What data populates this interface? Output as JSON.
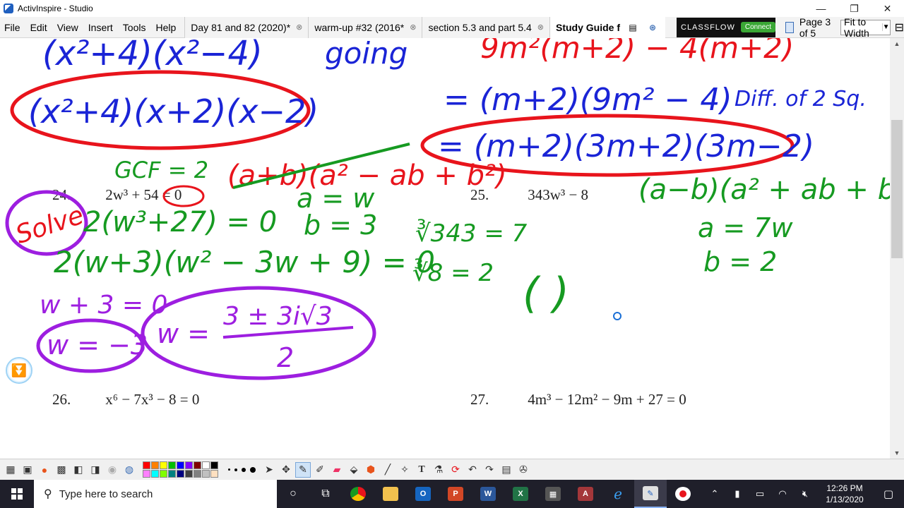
{
  "window": {
    "title": "ActivInspire - Studio",
    "controls": {
      "minimize": "—",
      "restore": "❐",
      "close": "✕"
    }
  },
  "menu": [
    "File",
    "Edit",
    "View",
    "Insert",
    "Tools",
    "Help"
  ],
  "tabs": [
    {
      "label": "Day 81 and 82 (2020)*",
      "active": false
    },
    {
      "label": "warm-up #32 (2016*",
      "active": false
    },
    {
      "label": "section 5.3 and part 5.4",
      "active": false
    },
    {
      "label": "Study Guide f",
      "active": true
    }
  ],
  "classflow": {
    "label": "CLASSFLOW",
    "connect": "Connect"
  },
  "page_indicator": "Page 3 of 5",
  "zoom": "Fit to Width",
  "problems": [
    {
      "num": "24.",
      "expr": "2w³ + 54 = 0"
    },
    {
      "num": "25.",
      "expr": "343w³ − 8"
    },
    {
      "num": "26.",
      "expr": "x⁶ − 7x³ − 8 = 0"
    },
    {
      "num": "27.",
      "expr": "4m³ − 12m² − 9m + 27 = 0"
    }
  ],
  "annotations": {
    "top_left_partial": "(x²+4)(x²−4)",
    "top_left_boxed": "(x²+4)(x+2)(x−2)",
    "top_middle_partial": "going",
    "top_right_red": "9m²(m+2) − 4(m+2)",
    "diff_squares_line": "= (m+2)(9m² − 4)",
    "diff_squares_note": "Diff. of 2 Sq.",
    "boxed_answer_right": "= (m+2)(3m+2)(3m−2)",
    "gcf": "GCF = 2",
    "sum_formula": "(a+b)(a² − ab + b²)",
    "solve": "Solve",
    "step1": "2(w³+27) = 0",
    "a_w": "a = w",
    "b_3": "b = 3",
    "step2": "2(w+3)(w² − 3w + 9) = 0",
    "w_plus_3": "w + 3 = 0",
    "w_neg3": "w = −3",
    "w_complex_lhs": "w =",
    "w_complex_num": "3 ± 3i√3",
    "w_complex_den": "2",
    "cube_root_343": "∛343 = 7",
    "cube_root_8": "∛8 = 2",
    "diff_formula": "(a−b)(a² + ab + b²)",
    "a_7w": "a = 7w",
    "b_2": "b = 2",
    "parens": "(          )"
  },
  "taskbar": {
    "search_placeholder": "Type here to search",
    "time": "12:26 PM",
    "date": "1/13/2020",
    "apps": [
      "cortana",
      "task-view",
      "chrome",
      "file-explorer",
      "outlook",
      "powerpoint",
      "word",
      "excel",
      "calculator",
      "access",
      "edge",
      "activinspire",
      "recorder"
    ]
  },
  "colors": {
    "ink_blue": "#1a24d6",
    "ink_red": "#e8141c",
    "ink_green": "#169a21",
    "ink_purple": "#9d1ee0",
    "taskbar": "#1f1f2a"
  },
  "palette": [
    "#ff0000",
    "#ff8000",
    "#ffff00",
    "#00c000",
    "#0000ff",
    "#8000ff",
    "#800000",
    "#ffffff",
    "#000000",
    "#ff80ff",
    "#00ffff",
    "#80ff00",
    "#008080",
    "#000080",
    "#404040",
    "#808080",
    "#c0c0c0",
    "#ffe0c0"
  ]
}
